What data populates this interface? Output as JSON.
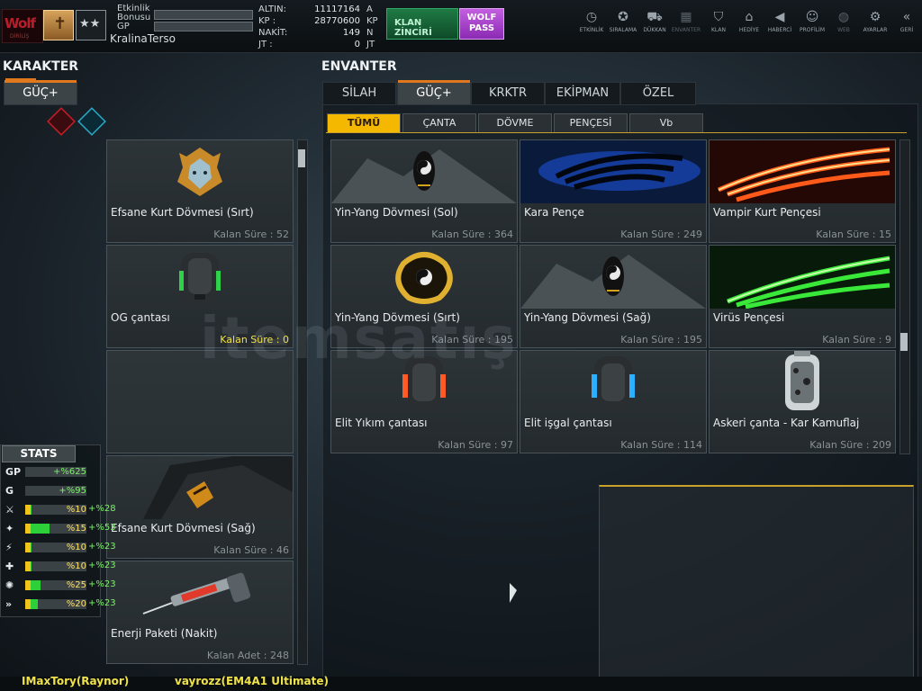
{
  "top": {
    "etkinlik_label": "Etkinlik\nBonusu",
    "gp_label": "GP",
    "username": "KralinaTerso",
    "currency": [
      {
        "label": "ALTIN:",
        "value": "11117164",
        "unit": "A"
      },
      {
        "label": "KP :",
        "value": "28770600",
        "unit": "KP"
      },
      {
        "label": "NAKİT:",
        "value": "149",
        "unit": "N"
      },
      {
        "label": "JT :",
        "value": "0",
        "unit": "JT"
      }
    ],
    "klan_button": "KLAN ZİNCİRİ",
    "wolf_button": "WOLF PASS",
    "menu": [
      {
        "icon": "clock-icon",
        "glyph": "◷",
        "label": "ETKİNLİK",
        "dim": false
      },
      {
        "icon": "medal-icon",
        "glyph": "✪",
        "label": "SIRALAMA",
        "dim": false
      },
      {
        "icon": "cart-icon",
        "glyph": "⛟",
        "label": "DÜKKAN",
        "dim": false
      },
      {
        "icon": "inventory-icon",
        "glyph": "▦",
        "label": "ENVANTER",
        "dim": true
      },
      {
        "icon": "shield-icon",
        "glyph": "⛉",
        "label": "KLAN",
        "dim": false
      },
      {
        "icon": "gift-icon",
        "glyph": "⌂",
        "label": "HEDİYE",
        "dim": false
      },
      {
        "icon": "megaphone-icon",
        "glyph": "◀",
        "label": "HABERCİ",
        "dim": false
      },
      {
        "icon": "profile-icon",
        "glyph": "☺",
        "label": "PROFİLİM",
        "dim": false
      },
      {
        "icon": "globe-icon",
        "glyph": "◍",
        "label": "WEB",
        "dim": true
      },
      {
        "icon": "gear-icon",
        "glyph": "⚙",
        "label": "AYARLAR",
        "dim": false
      },
      {
        "icon": "back-icon",
        "glyph": "«",
        "label": "GERİ",
        "dim": false
      }
    ]
  },
  "karakter": {
    "title": "KARAKTER",
    "tab": "GÜÇ+",
    "items": [
      {
        "name": "Efsane Kurt Dövmesi (Sırt)",
        "time": "Kalan Süre : 52",
        "art": "wolf"
      },
      {
        "name": "OG çantası",
        "time": "Kalan Süre : 0",
        "art": "bag-green",
        "yellow": true
      },
      {
        "name": "",
        "time": "",
        "art": "empty"
      },
      {
        "name": "Efsane Kurt Dövmesi (Sağ)",
        "time": "Kalan Süre : 46",
        "art": "arm"
      },
      {
        "name": "Enerji Paketi (Nakit)",
        "time": "Kalan Adet : 248",
        "art": "syringe"
      }
    ]
  },
  "stats": {
    "title": "STATS",
    "rows": [
      {
        "icon": "GP",
        "fill": 0,
        "val": "+%625",
        "bonus": ""
      },
      {
        "icon": "G",
        "fill": 0,
        "val": "+%95",
        "bonus": ""
      },
      {
        "icon": "⚔",
        "fill": 0.1,
        "val": "%10",
        "bonus": "+%28"
      },
      {
        "icon": "✦",
        "fill": 0.4,
        "val": "%15",
        "bonus": "+%53"
      },
      {
        "icon": "⚡",
        "fill": 0.1,
        "val": "%10",
        "bonus": "+%23"
      },
      {
        "icon": "✚",
        "fill": 0.1,
        "val": "%10",
        "bonus": "+%23"
      },
      {
        "icon": "✺",
        "fill": 0.25,
        "val": "%25",
        "bonus": "+%23"
      },
      {
        "icon": "»",
        "fill": 0.2,
        "val": "%20",
        "bonus": "+%23"
      }
    ]
  },
  "envanter": {
    "title": "ENVANTER",
    "tabs": [
      "SİLAH",
      "GÜÇ+",
      "KRKTR",
      "EKİPMAN",
      "ÖZEL"
    ],
    "active_tab": 1,
    "subtabs": [
      "TÜMÜ",
      "ÇANTA",
      "DÖVME",
      "PENÇESİ",
      "Vb"
    ],
    "active_subtab": 0,
    "items": [
      {
        "name": "Yin-Yang Dövmesi (Sol)",
        "time": "Kalan Süre : 364",
        "art": "yinyang"
      },
      {
        "name": "Kara Pençe",
        "time": "Kalan Süre : 249",
        "art": "blueclaw"
      },
      {
        "name": "Vampir Kurt Pençesi",
        "time": "Kalan Süre : 15",
        "art": "fireclaw"
      },
      {
        "name": "Yin-Yang Dövmesi (Sırt)",
        "time": "Kalan Süre : 195",
        "art": "dragon"
      },
      {
        "name": "Yin-Yang Dövmesi (Sağ)",
        "time": "Kalan Süre : 195",
        "art": "yinyang"
      },
      {
        "name": "Virüs Pençesi",
        "time": "Kalan Süre : 9",
        "art": "greenclaw"
      },
      {
        "name": "Elit Yıkım çantası",
        "time": "Kalan Süre : 97",
        "art": "bag-red"
      },
      {
        "name": "Elit işgal çantası",
        "time": "Kalan Süre : 114",
        "art": "bag-blue"
      },
      {
        "name": "Askeri çanta - Kar Kamuflaj",
        "time": "Kalan Süre : 209",
        "art": "bag-camo"
      }
    ]
  },
  "watermark": "itemsatış",
  "players": [
    "IMaxTory(Raynor)",
    "vayrozz(EM4A1 Ultimate)"
  ],
  "colors": {
    "accent": "#e0781e",
    "subtab_active": "#f5b800",
    "stat_green": "#2ed03a",
    "stat_yellow": "#f0c41a"
  }
}
